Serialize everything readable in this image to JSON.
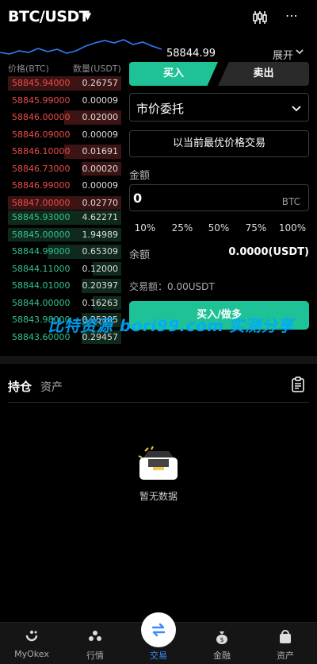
{
  "header": {
    "pair": "BTC/USDT",
    "caret_icon": "caret-down-icon",
    "chart_icon": "candlestick-icon",
    "more_icon": "more-dots-icon"
  },
  "ticker": {
    "last_price": "58844.99",
    "expand_label": "展开",
    "expand_icon": "chevron-down-icon"
  },
  "orderbook": {
    "price_header": "价格(BTC)",
    "qty_header": "数量(USDT)",
    "asks": [
      {
        "price": "58845.94000",
        "qty": "0.26757",
        "depth": 1.0
      },
      {
        "price": "58845.99000",
        "qty": "0.00009",
        "depth": 0.0
      },
      {
        "price": "58846.00000",
        "qty": "0.02000",
        "depth": 0.5
      },
      {
        "price": "58846.09000",
        "qty": "0.00009",
        "depth": 0.0
      },
      {
        "price": "58846.10000",
        "qty": "0.01691",
        "depth": 0.5
      },
      {
        "price": "58846.73000",
        "qty": "0.00020",
        "depth": 0.35
      },
      {
        "price": "58846.99000",
        "qty": "0.00009",
        "depth": 0.0
      },
      {
        "price": "58847.00000",
        "qty": "0.02770",
        "depth": 1.0
      }
    ],
    "bids": [
      {
        "price": "58845.93000",
        "qty": "4.62271",
        "depth": 1.0
      },
      {
        "price": "58845.00000",
        "qty": "1.94989",
        "depth": 1.0
      },
      {
        "price": "58844.99000",
        "qty": "0.65309",
        "depth": 0.65
      },
      {
        "price": "58844.11000",
        "qty": "0.12000",
        "depth": 0.25
      },
      {
        "price": "58844.01000",
        "qty": "0.20397",
        "depth": 0.35
      },
      {
        "price": "58844.00000",
        "qty": "0.16263",
        "depth": 0.25
      },
      {
        "price": "58843.98000",
        "qty": "0.25305",
        "depth": 0.35
      },
      {
        "price": "58843.60000",
        "qty": "0.29457",
        "depth": 0.35
      }
    ]
  },
  "trade": {
    "buy_tab": "买入",
    "sell_tab": "卖出",
    "order_type": "市价委托",
    "best_price_btn": "以当前最优价格交易",
    "amount_label": "金额",
    "amount_value": "0",
    "amount_unit": "BTC",
    "percents": [
      "10%",
      "25%",
      "50%",
      "75%",
      "100%"
    ],
    "balance_label": "余额",
    "balance_value": "0.0000(USDT)",
    "trade_amount": "交易额：0.00USDT",
    "submit": "买入/做多"
  },
  "watermark": "比特资源 bori99.com 实测分享",
  "positions": {
    "hold_tab": "持仓",
    "asset_tab": "资产",
    "empty_text": "暂无数据"
  },
  "nav": [
    {
      "label": "MyOkex",
      "icon": "okex-logo-icon"
    },
    {
      "label": "行情",
      "icon": "market-icon"
    },
    {
      "label": "交易",
      "icon": "trade-swap-icon"
    },
    {
      "label": "金融",
      "icon": "finance-bag-icon"
    },
    {
      "label": "资产",
      "icon": "wallet-icon"
    }
  ],
  "colors": {
    "accent": "#1fc296",
    "ask": "#ee4b4b",
    "bid": "#31c48d",
    "nav_active": "#3a8bff"
  }
}
